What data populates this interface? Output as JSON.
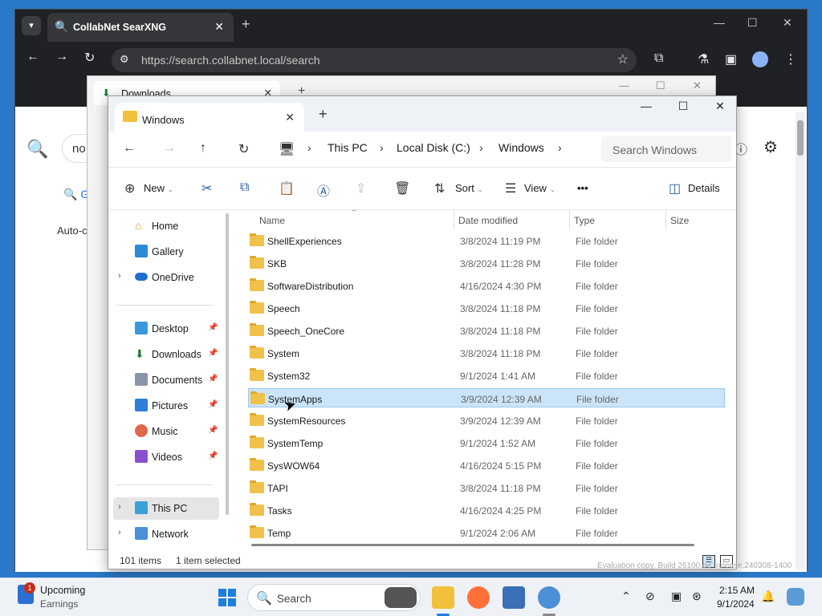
{
  "browser": {
    "tab_title": "CollabNet SearXNG",
    "url": "https://search.collabnet.local/search",
    "search_query": "no",
    "search_tab": "G",
    "autocomplete_label": "Auto-c"
  },
  "background_window": {
    "tab_title": "Downloads"
  },
  "explorer": {
    "tab_title": "Windows",
    "breadcrumb": [
      "This PC",
      "Local Disk (C:)",
      "Windows"
    ],
    "search_placeholder": "Search Windows",
    "commands": {
      "new": "New",
      "sort": "Sort",
      "view": "View",
      "more": "•••",
      "details": "Details"
    },
    "columns": {
      "name": "Name",
      "date": "Date modified",
      "type": "Type",
      "size": "Size"
    },
    "nav": {
      "home": "Home",
      "gallery": "Gallery",
      "onedrive": "OneDrive",
      "desktop": "Desktop",
      "downloads": "Downloads",
      "documents": "Documents",
      "pictures": "Pictures",
      "music": "Music",
      "videos": "Videos",
      "thispc": "This PC",
      "network": "Network"
    },
    "files": [
      {
        "name": "ShellExperiences",
        "date": "3/8/2024 11:19 PM",
        "type": "File folder"
      },
      {
        "name": "SKB",
        "date": "3/8/2024 11:28 PM",
        "type": "File folder"
      },
      {
        "name": "SoftwareDistribution",
        "date": "4/16/2024 4:30 PM",
        "type": "File folder"
      },
      {
        "name": "Speech",
        "date": "3/8/2024 11:18 PM",
        "type": "File folder"
      },
      {
        "name": "Speech_OneCore",
        "date": "3/8/2024 11:18 PM",
        "type": "File folder"
      },
      {
        "name": "System",
        "date": "3/8/2024 11:18 PM",
        "type": "File folder"
      },
      {
        "name": "System32",
        "date": "9/1/2024 1:41 AM",
        "type": "File folder"
      },
      {
        "name": "SystemApps",
        "date": "3/9/2024 12:39 AM",
        "type": "File folder",
        "selected": true
      },
      {
        "name": "SystemResources",
        "date": "3/9/2024 12:39 AM",
        "type": "File folder"
      },
      {
        "name": "SystemTemp",
        "date": "9/1/2024 1:52 AM",
        "type": "File folder"
      },
      {
        "name": "SysWOW64",
        "date": "4/16/2024 5:15 PM",
        "type": "File folder"
      },
      {
        "name": "TAPI",
        "date": "3/8/2024 11:18 PM",
        "type": "File folder"
      },
      {
        "name": "Tasks",
        "date": "4/16/2024 4:25 PM",
        "type": "File folder"
      },
      {
        "name": "Temp",
        "date": "9/1/2024 2:06 AM",
        "type": "File folder"
      }
    ],
    "status_count": "101 items",
    "status_selected": "1 item selected"
  },
  "taskbar": {
    "widget_title": "Upcoming",
    "widget_sub": "Earnings",
    "badge": "1",
    "search": "Search",
    "time": "2:15 AM",
    "date": "9/1/2024"
  },
  "watermark": "Evaluation copy. Build 26100.ge_release.240308-1400",
  "colors": {
    "accent": "#1c7fe0",
    "folder": "#f0c14b",
    "selection": "#cce4f7"
  }
}
